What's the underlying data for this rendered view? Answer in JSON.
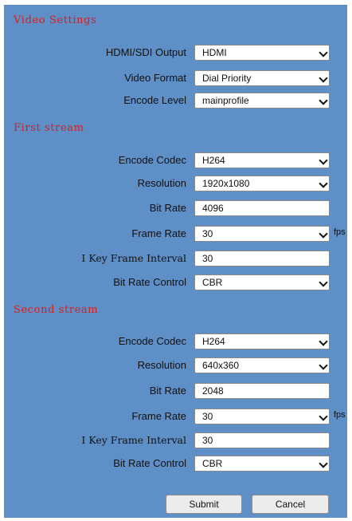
{
  "video_settings": {
    "title": "Video Settings",
    "hdmi_sdi_output": {
      "label": "HDMI/SDI Output",
      "value": "HDMI"
    },
    "video_format": {
      "label": "Video Format",
      "value": "Dial Priority"
    },
    "encode_level": {
      "label": "Encode Level",
      "value": "mainprofile"
    }
  },
  "first_stream": {
    "title": "First stream",
    "encode_codec": {
      "label": "Encode Codec",
      "value": "H264"
    },
    "resolution": {
      "label": "Resolution",
      "value": "1920x1080"
    },
    "bit_rate": {
      "label": "Bit Rate",
      "value": "4096"
    },
    "frame_rate": {
      "label": "Frame Rate",
      "value": "30",
      "unit": "fps"
    },
    "i_key_frame_interval": {
      "label": "I Key Frame Interval",
      "value": "30"
    },
    "bit_rate_control": {
      "label": "Bit Rate Control",
      "value": "CBR"
    }
  },
  "second_stream": {
    "title": "Second stream",
    "encode_codec": {
      "label": "Encode Codec",
      "value": "H264"
    },
    "resolution": {
      "label": "Resolution",
      "value": "640x360"
    },
    "bit_rate": {
      "label": "Bit Rate",
      "value": "2048"
    },
    "frame_rate": {
      "label": "Frame Rate",
      "value": "30",
      "unit": "fps"
    },
    "i_key_frame_interval": {
      "label": "I Key Frame Interval",
      "value": "30"
    },
    "bit_rate_control": {
      "label": "Bit Rate Control",
      "value": "CBR"
    }
  },
  "buttons": {
    "submit": "Submit",
    "cancel": "Cancel"
  },
  "colors": {
    "panel": "#5f8fc7",
    "section_title": "#d81e1e"
  },
  "icons": {
    "dropdown": "chevron-down-icon"
  }
}
